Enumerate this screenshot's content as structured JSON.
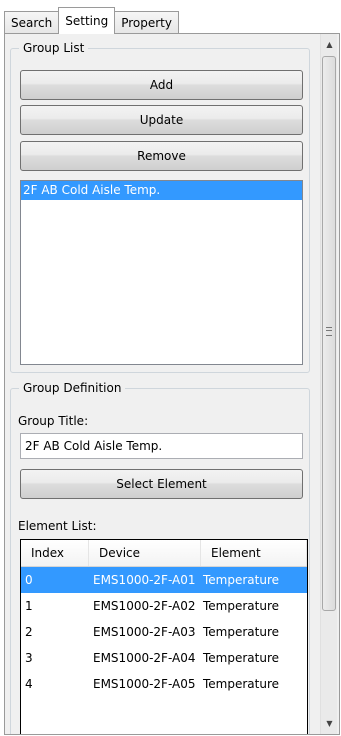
{
  "tabs": [
    {
      "label": "Search",
      "active": false
    },
    {
      "label": "Setting",
      "active": true
    },
    {
      "label": "Property",
      "active": false
    }
  ],
  "group_list": {
    "legend": "Group List",
    "buttons": {
      "add": "Add",
      "update": "Update",
      "remove": "Remove"
    },
    "items": [
      {
        "label": "2F AB Cold Aisle Temp.",
        "selected": true
      }
    ]
  },
  "group_definition": {
    "legend": "Group Definition",
    "title_label": "Group Title:",
    "title_value": "2F AB Cold Aisle Temp.",
    "select_element_button": "Select Element",
    "element_list_label": "Element List:",
    "columns": [
      "Index",
      "Device",
      "Element"
    ],
    "rows": [
      {
        "index": "0",
        "device": "EMS1000-2F-A01",
        "element": "Temperature",
        "selected": true
      },
      {
        "index": "1",
        "device": "EMS1000-2F-A02",
        "element": "Temperature",
        "selected": false
      },
      {
        "index": "2",
        "device": "EMS1000-2F-A03",
        "element": "Temperature",
        "selected": false
      },
      {
        "index": "3",
        "device": "EMS1000-2F-A04",
        "element": "Temperature",
        "selected": false
      },
      {
        "index": "4",
        "device": "EMS1000-2F-A05",
        "element": "Temperature",
        "selected": false
      }
    ]
  },
  "colors": {
    "selection": "#3399ff",
    "panel_bg": "#f0f0f0"
  },
  "icons": {
    "scroll_up": "chevron-up-icon",
    "scroll_down": "chevron-down-icon",
    "scroll_grip": "grip-icon"
  }
}
